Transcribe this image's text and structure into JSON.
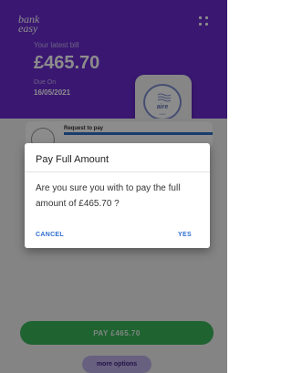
{
  "header": {
    "logo_line1": "bank",
    "logo_line2": "easy",
    "latest_bill_label": "Your latest bill",
    "amount": "£465.70",
    "due_label": "Due On",
    "due_date": "16/05/2021"
  },
  "biller": {
    "name": "aire",
    "sub": "water",
    "icon": "water-waves-icon"
  },
  "request": {
    "label": "Request to pay"
  },
  "dialog": {
    "title": "Pay Full Amount",
    "message": "Are you sure you with to pay the full amount of £465.70 ?",
    "cancel_label": "CANCEL",
    "yes_label": "YES"
  },
  "actions": {
    "pay_label": "PAY £465.70",
    "more_label": "more options"
  },
  "colors": {
    "header": "#6a2ccf",
    "pay": "#39b55a",
    "more": "#bcb0e8",
    "link": "#2f6fd0"
  }
}
